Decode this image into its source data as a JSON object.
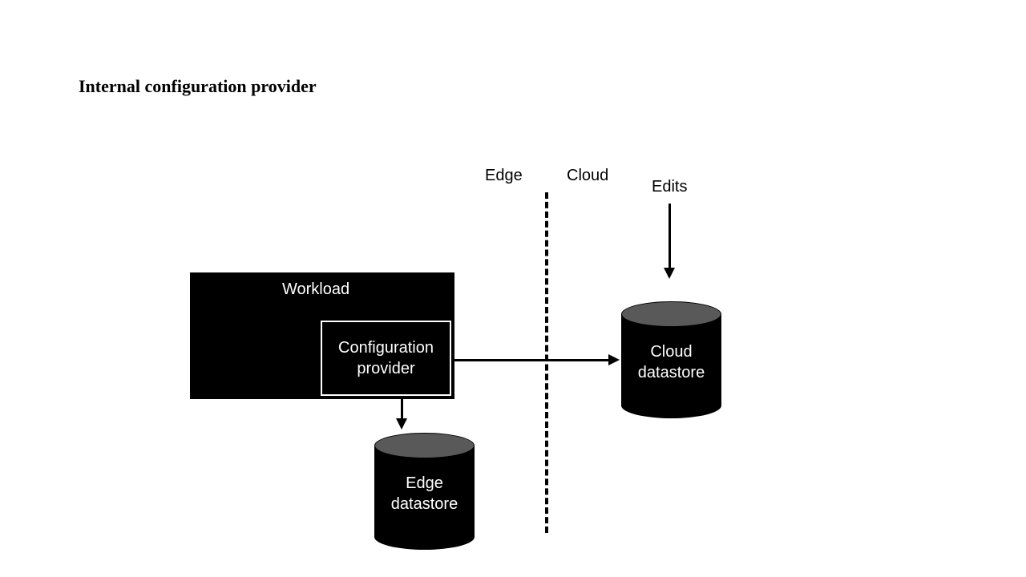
{
  "title": "Internal configuration provider",
  "regions": {
    "edge": "Edge",
    "cloud": "Cloud"
  },
  "edits_label": "Edits",
  "workload": {
    "label": "Workload",
    "config_provider": "Configuration\nprovider"
  },
  "datastores": {
    "edge": "Edge\ndatastore",
    "cloud": "Cloud\ndatastore"
  }
}
